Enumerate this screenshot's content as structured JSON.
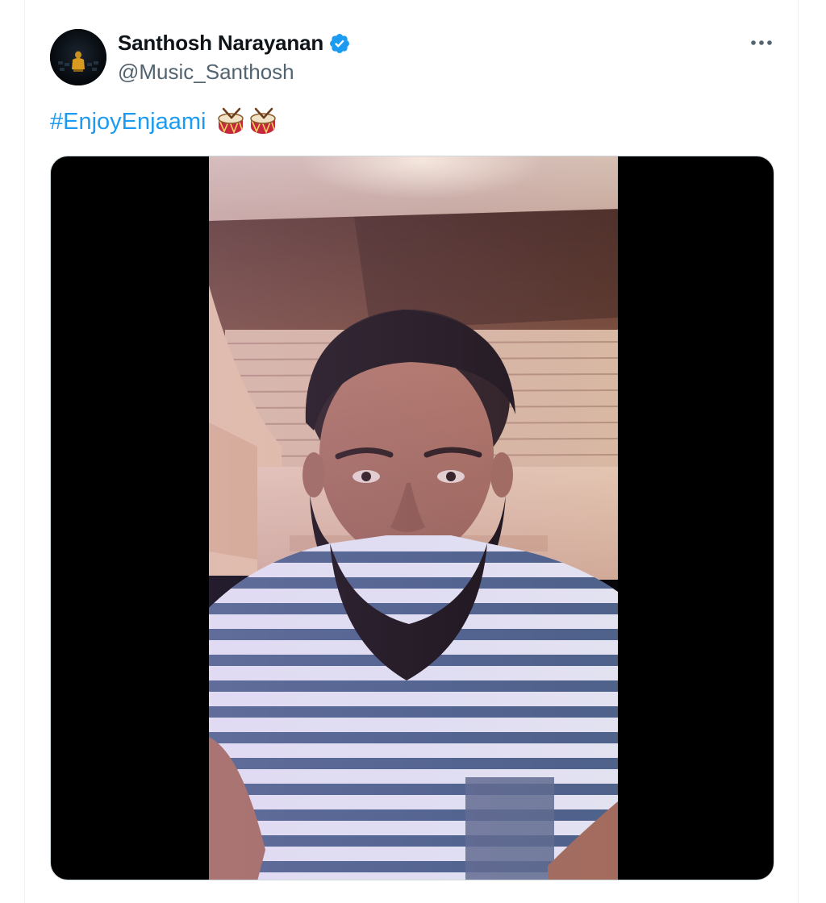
{
  "author": {
    "display_name": "Santhosh Narayanan",
    "handle": "@Music_Santhosh",
    "verified": true,
    "avatar_icon": "profile-avatar"
  },
  "tweet": {
    "hashtag": "#EnjoyEnjaami",
    "emoji": [
      "drum-emoji",
      "drum-emoji"
    ]
  },
  "media": {
    "type": "video",
    "description_icon": "video-thumbnail"
  },
  "icons": {
    "more": "more-options-icon",
    "verified": "verified-badge-icon"
  },
  "colors": {
    "link": "#1d9bf0",
    "name": "#0f1419",
    "handle": "#536471",
    "verified": "#1d9bf0"
  }
}
